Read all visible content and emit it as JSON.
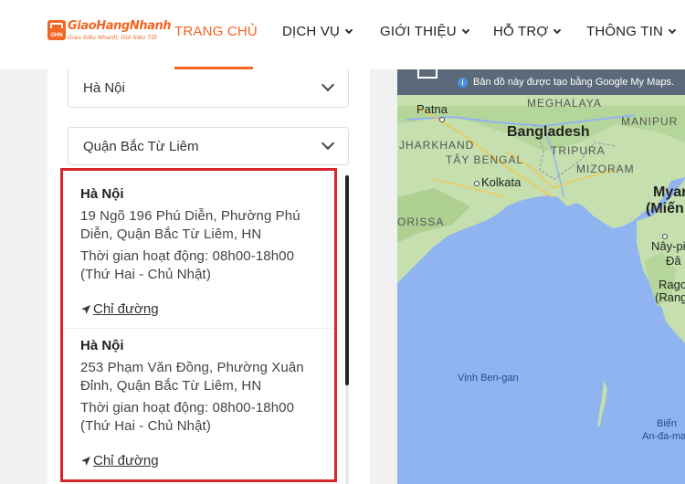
{
  "brand": {
    "name": "GiaoHangNhanh",
    "tagline": "Giao Siêu Nhanh, Giá Siêu Tốt",
    "badge": "GHN",
    "color": "#f26522"
  },
  "nav": {
    "items": [
      {
        "label": "TRANG CHỦ",
        "active": true
      },
      {
        "label": "DỊCH VỤ",
        "has_dropdown": true
      },
      {
        "label": "GIỚI THIỆU",
        "has_dropdown": true
      },
      {
        "label": "HỖ TRỢ",
        "has_dropdown": true
      },
      {
        "label": "THÔNG TIN",
        "has_dropdown": true
      }
    ]
  },
  "filters": {
    "province": "Hà Nội",
    "district": "Quận Bắc Từ Liêm"
  },
  "stores": [
    {
      "title": "Hà Nội",
      "address": "19 Ngõ 196 Phú Diễn, Phường Phú Diễn, Quận Bắc Từ Liêm, HN",
      "hours": "Thời gian hoạt động: 08h00-18h00 (Thứ Hai - Chủ Nhật)",
      "directions": "Chỉ đường"
    },
    {
      "title": "Hà Nội",
      "address": "253 Phạm Văn Đồng, Phường Xuân Đỉnh, Quận Bắc Từ Liêm, HN",
      "hours": "Thời gian hoạt động: 08h00-18h00 (Thứ Hai - Chủ Nhật)",
      "directions": "Chỉ đường"
    }
  ],
  "map": {
    "info_text": "Bản đồ này được tạo bằng Google My Maps.",
    "labels": {
      "patna": "Patna",
      "meghalaya": "MEGHALAYA",
      "manipur": "MANIPUR",
      "jharkhand": "JHARKHAND",
      "bangladesh": "Bangladesh",
      "tay_bengal": "TÂY BENGAL",
      "tripura": "TRIPURA",
      "mizoram": "MIZORAM",
      "kolkata": "Kolkata",
      "orissa": "ORISSA",
      "myan": "Myan",
      "mien": "(Miến",
      "naypi": "Nây-pi",
      "dau": "Đâ",
      "rago": "Rago",
      "rangoon": "(Rango",
      "vinh_ben_gan": "Vịnh Ben-gan",
      "bien": "Biển",
      "an_da_man": "An-đa-ma"
    }
  }
}
